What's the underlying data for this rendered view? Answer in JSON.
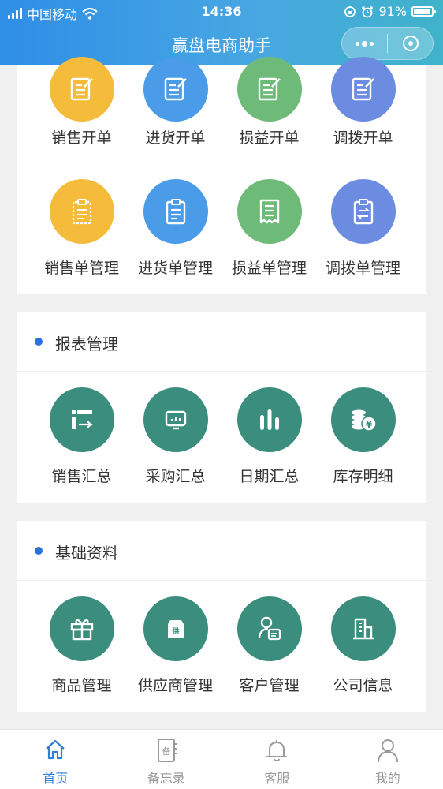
{
  "status_bar": {
    "carrier": "中国移动",
    "time": "14:36",
    "battery": "91%"
  },
  "nav": {
    "title": "赢盘电商助手"
  },
  "orders": {
    "row1": [
      {
        "label": "销售开单",
        "color": "#f5bb3b",
        "icon": "edit-document-icon"
      },
      {
        "label": "进货开单",
        "color": "#4a9be8",
        "icon": "edit-document-icon"
      },
      {
        "label": "损益开单",
        "color": "#6ebb79",
        "icon": "edit-document-icon"
      },
      {
        "label": "调拨开单",
        "color": "#6b8ce0",
        "icon": "edit-document-icon"
      }
    ],
    "row2": [
      {
        "label": "销售单管理",
        "color": "#f5bb3b",
        "icon": "clipboard-icon"
      },
      {
        "label": "进货单管理",
        "color": "#4a9be8",
        "icon": "clipboard-icon"
      },
      {
        "label": "损益单管理",
        "color": "#6ebb79",
        "icon": "receipt-icon"
      },
      {
        "label": "调拨单管理",
        "color": "#6b8ce0",
        "icon": "transfer-clipboard-icon"
      }
    ]
  },
  "reports": {
    "title": "报表管理",
    "items": [
      {
        "label": "销售汇总",
        "icon": "sales-summary-icon"
      },
      {
        "label": "采购汇总",
        "icon": "purchase-summary-icon"
      },
      {
        "label": "日期汇总",
        "icon": "bar-chart-icon"
      },
      {
        "label": "库存明细",
        "icon": "coins-yen-icon"
      }
    ]
  },
  "basics": {
    "title": "基础资料",
    "items": [
      {
        "label": "商品管理",
        "icon": "gift-icon"
      },
      {
        "label": "供应商管理",
        "icon": "supplier-store-icon",
        "badge": "供"
      },
      {
        "label": "客户管理",
        "icon": "customer-card-icon"
      },
      {
        "label": "公司信息",
        "icon": "building-icon"
      }
    ]
  },
  "tabbar": [
    {
      "label": "首页",
      "icon": "home-icon",
      "active": true
    },
    {
      "label": "备忘录",
      "icon": "memo-icon",
      "badge": "备"
    },
    {
      "label": "客服",
      "icon": "bell-icon"
    },
    {
      "label": "我的",
      "icon": "user-icon"
    }
  ],
  "colors": {
    "accent": "#2f7fd9",
    "teal": "#3b8e7e",
    "section_dot": "#2c6fe0"
  }
}
